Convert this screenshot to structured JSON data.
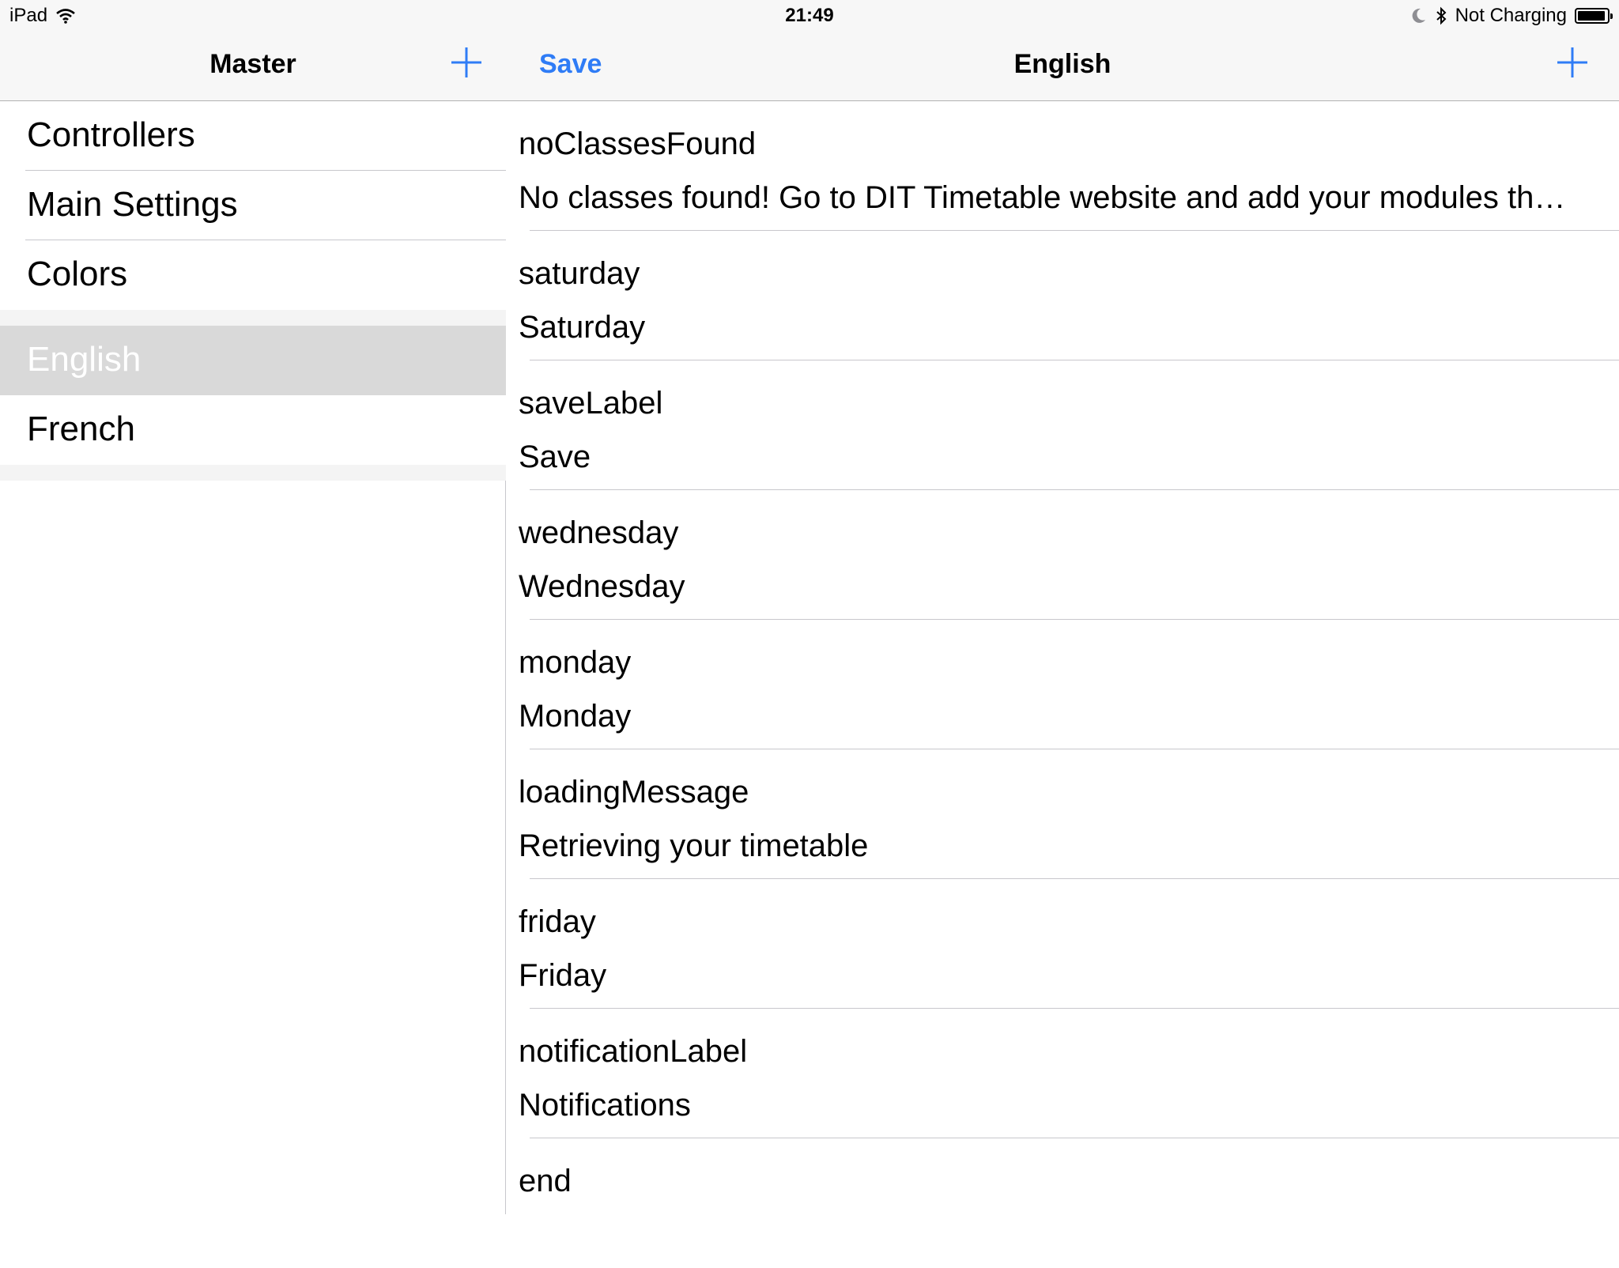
{
  "status_bar": {
    "device": "iPad",
    "time": "21:49",
    "charging_status": "Not Charging",
    "battery_level": 0.95,
    "icons": [
      "wifi-icon",
      "moon-icon",
      "bluetooth-icon",
      "battery-icon"
    ]
  },
  "master": {
    "title": "Master",
    "add_icon": "plus-icon",
    "sections": [
      {
        "items": [
          {
            "label": "Controllers"
          },
          {
            "label": "Main Settings"
          },
          {
            "label": "Colors"
          }
        ]
      },
      {
        "items": [
          {
            "label": "English",
            "selected": true
          },
          {
            "label": "French"
          }
        ]
      }
    ]
  },
  "detail": {
    "title": "English",
    "save_label": "Save",
    "add_icon": "plus-icon",
    "rows": [
      {
        "key": "noClassesFound",
        "value": "No classes found! Go to DIT Timetable website and add your modules th…"
      },
      {
        "key": "saturday",
        "value": "Saturday"
      },
      {
        "key": "saveLabel",
        "value": "Save"
      },
      {
        "key": "wednesday",
        "value": "Wednesday"
      },
      {
        "key": "monday",
        "value": "Monday"
      },
      {
        "key": "loadingMessage",
        "value": "Retrieving your timetable"
      },
      {
        "key": "friday",
        "value": "Friday"
      },
      {
        "key": "notificationLabel",
        "value": "Notifications"
      },
      {
        "key": "end",
        "value": ""
      }
    ]
  },
  "colors": {
    "accent": "#2f7cf6",
    "selected_row": "#d9d9d9",
    "separator": "#c8c7cc",
    "navbar": "#f7f7f7"
  }
}
